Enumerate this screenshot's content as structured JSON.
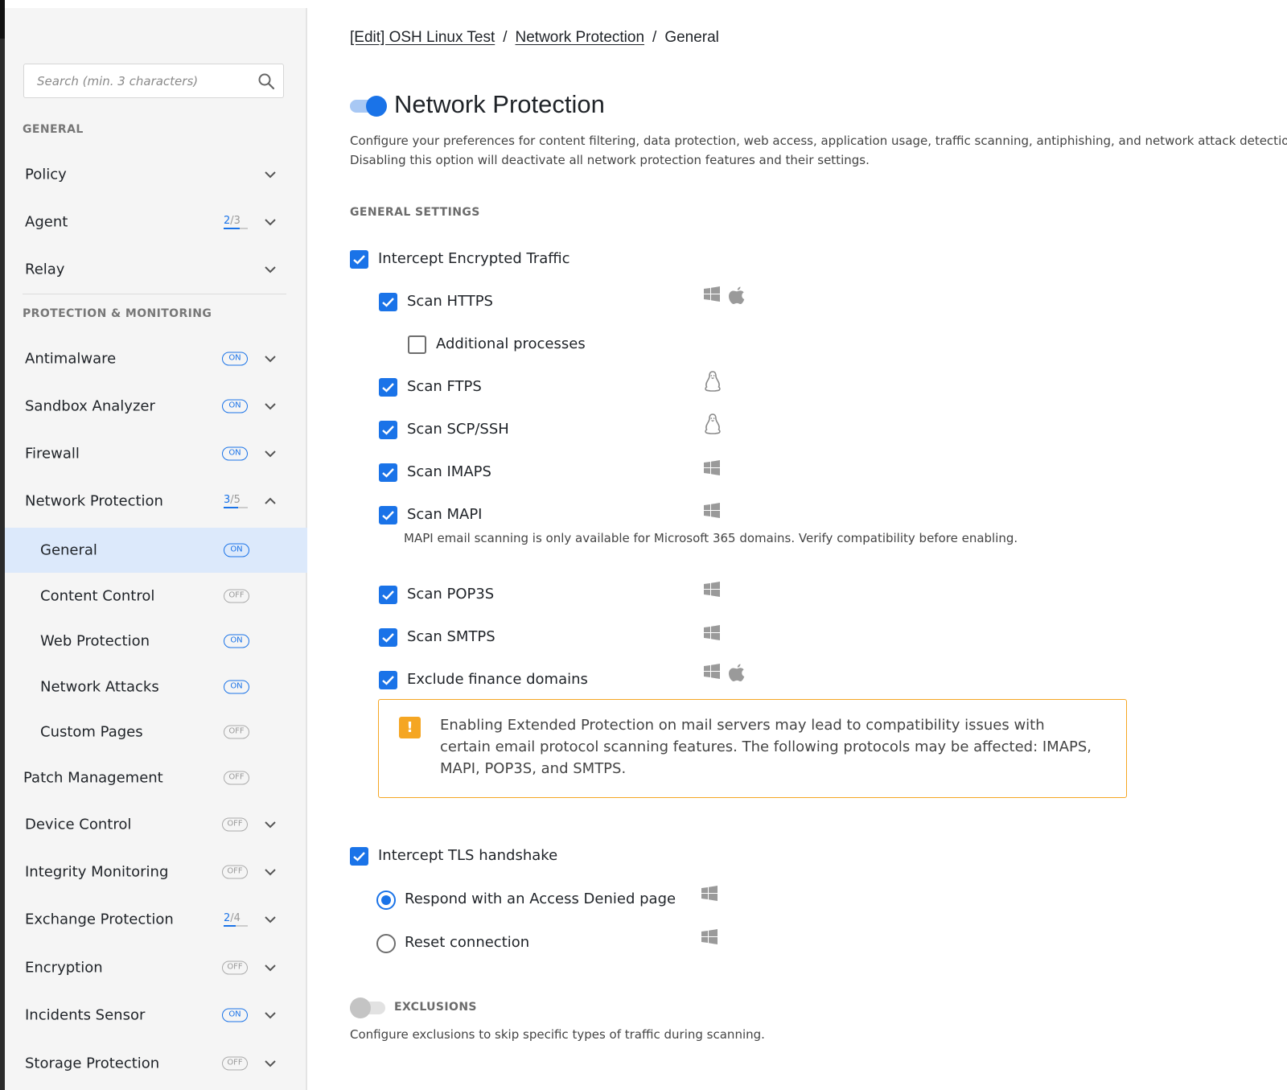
{
  "sidebar": {
    "search_placeholder": "Search (min. 3 characters)",
    "section_general": "GENERAL",
    "section_protection": "PROTECTION & MONITORING",
    "general_items": [
      {
        "label": "Policy"
      },
      {
        "label": "Agent",
        "count": "2",
        "total": "3"
      },
      {
        "label": "Relay"
      }
    ],
    "protection_items": [
      {
        "label": "Antimalware",
        "badge": "ON"
      },
      {
        "label": "Sandbox Analyzer",
        "badge": "ON"
      },
      {
        "label": "Firewall",
        "badge": "ON"
      },
      {
        "label": "Network Protection",
        "count": "3",
        "total": "5",
        "expanded": true
      },
      {
        "label": "General",
        "badge": "ON",
        "selected": true
      },
      {
        "label": "Content Control",
        "badge": "OFF"
      },
      {
        "label": "Web Protection",
        "badge": "ON"
      },
      {
        "label": "Network Attacks",
        "badge": "ON"
      },
      {
        "label": "Custom Pages",
        "badge": "OFF"
      },
      {
        "label": "Patch Management",
        "badge": "OFF"
      },
      {
        "label": "Device Control",
        "badge": "OFF"
      },
      {
        "label": "Integrity Monitoring",
        "badge": "OFF"
      },
      {
        "label": "Exchange Protection",
        "count": "2",
        "total": "4"
      },
      {
        "label": "Encryption",
        "badge": "OFF"
      },
      {
        "label": "Incidents Sensor",
        "badge": "ON"
      },
      {
        "label": "Storage Protection",
        "badge": "OFF"
      }
    ]
  },
  "breadcrumb": {
    "item1": "[Edit] OSH Linux Test",
    "item2": "Network Protection",
    "current": "General",
    "separator": "/"
  },
  "main": {
    "title": "Network Protection",
    "description_line1": "Configure your preferences for content filtering, data protection, web access, application usage, traffic scanning, antiphishing, and network attack detection.",
    "description_line2": "Disabling this option will deactivate all network protection features and their settings.",
    "general_settings_heading": "GENERAL SETTINGS",
    "intercept_encrypted": "Intercept Encrypted Traffic",
    "scan_https": "Scan HTTPS",
    "additional_processes": "Additional processes",
    "scan_ftps": "Scan FTPS",
    "scan_scp": "Scan SCP/SSH",
    "scan_imaps": "Scan IMAPS",
    "scan_mapi": "Scan MAPI",
    "mapi_note": "MAPI email scanning is only available for Microsoft 365 domains. Verify compatibility before enabling.",
    "scan_pop3s": "Scan POP3S",
    "scan_smtps": "Scan SMTPS",
    "exclude_finance": "Exclude finance domains",
    "warning_text": "Enabling Extended Protection on mail servers may lead to compatibility issues with certain email protocol scanning features. The following protocols may be affected: IMAPS, MAPI, POP3S, and SMTPS.",
    "warning_icon": "!",
    "intercept_tls": "Intercept TLS handshake",
    "respond_access_denied": "Respond with an Access Denied page",
    "reset_connection": "Reset connection",
    "exclusions_heading": "EXCLUSIONS",
    "exclusions_desc": "Configure exclusions to skip specific types of traffic during scanning."
  },
  "colors": {
    "accent": "#1a73e8",
    "warning": "#f5a623",
    "selected_bg": "#dce9fb"
  }
}
